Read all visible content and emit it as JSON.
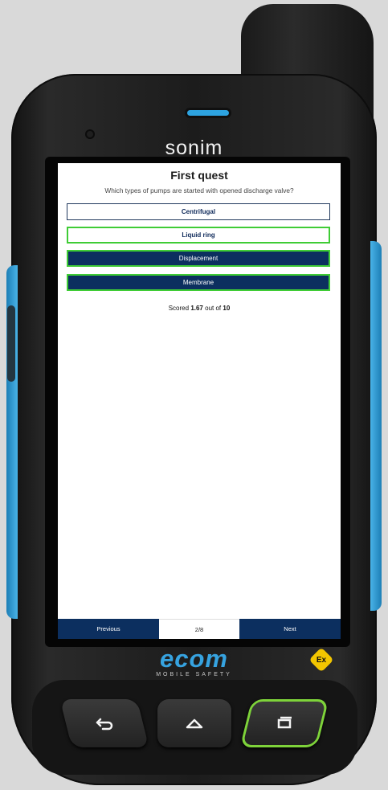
{
  "device": {
    "brand_top": "sonim",
    "brand_bottom": "ecom",
    "brand_bottom_tagline": "MOBILE SAFETY",
    "ex_badge": "Ex",
    "accent_color": "#36a3e0"
  },
  "quiz": {
    "title": "First quest",
    "question": "Which types of pumps are started with opened discharge valve?",
    "answers": [
      {
        "label": "Centrifugal",
        "state": "unselected"
      },
      {
        "label": "Liquid ring",
        "state": "correct-outline"
      },
      {
        "label": "Displacement",
        "state": "selected-correct"
      },
      {
        "label": "Membrane",
        "state": "selected-correct"
      }
    ],
    "score_prefix": "Scored",
    "score_value": "1.67",
    "score_mid": "out of",
    "score_total": "10"
  },
  "nav": {
    "previous_label": "Previous",
    "page_indicator": "2/8",
    "next_label": "Next"
  },
  "keys": {
    "back_icon": "back-arrow-icon",
    "home_icon": "home-icon",
    "recent_icon": "recent-apps-icon"
  },
  "colors": {
    "answer_fill": "#0c2f5f",
    "answer_correct_border": "#3fcc35"
  }
}
